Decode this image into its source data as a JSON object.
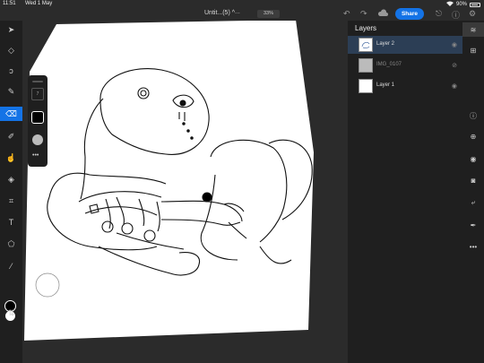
{
  "status": {
    "time": "11:51",
    "date": "Wed 1 May",
    "battery": "90%"
  },
  "document": {
    "title": "Untit...(5)",
    "title_chevron": "^",
    "zoom": "33%",
    "more": "..."
  },
  "toolbar": {
    "undo_icon": "undo-icon",
    "redo_icon": "redo-icon",
    "cloud_icon": "cloud-icon",
    "share_label": "Share",
    "share_color": "#1473e6",
    "export_icon": "export-icon",
    "help_icon": "help-icon",
    "settings_icon": "gear-icon"
  },
  "left_tools": [
    {
      "name": "move-icon",
      "glyph": "➤"
    },
    {
      "name": "transform-icon",
      "glyph": "◇"
    },
    {
      "name": "lasso-icon",
      "glyph": "ↄ"
    },
    {
      "name": "brush-icon",
      "glyph": "✎"
    },
    {
      "name": "eraser-icon",
      "glyph": "⌫",
      "active": true
    },
    {
      "name": "dropper-brush-icon",
      "glyph": "✐"
    },
    {
      "name": "smudge-icon",
      "glyph": "☝"
    },
    {
      "name": "fill-icon",
      "glyph": "◈"
    },
    {
      "name": "crop-icon",
      "glyph": "⌗"
    },
    {
      "name": "type-icon",
      "glyph": "T"
    },
    {
      "name": "shapes-icon",
      "glyph": "⬠"
    },
    {
      "name": "eyedropper-icon",
      "glyph": "⁄"
    },
    {
      "name": "swap-colors-icon",
      "glyph": "⇅"
    }
  ],
  "brush_panel": {
    "size": "7",
    "more": "•••"
  },
  "colors": {
    "foreground": "#000000",
    "background": "#ffffff",
    "accent": "#1473e6"
  },
  "layers": {
    "title": "Layers",
    "items": [
      {
        "name": "Layer 2",
        "selected": true,
        "visible": true
      },
      {
        "name": "IMG_0107",
        "selected": false,
        "visible": false
      },
      {
        "name": "Layer 1",
        "selected": false,
        "visible": true
      }
    ]
  },
  "right_tools": [
    {
      "name": "layers-icon",
      "active": true
    },
    {
      "name": "layer-properties-icon"
    },
    {
      "name": "info-icon"
    },
    {
      "name": "add-layer-icon"
    },
    {
      "name": "visibility-icon"
    },
    {
      "name": "mask-icon"
    },
    {
      "name": "clipping-icon"
    },
    {
      "name": "adjust-icon"
    },
    {
      "name": "more-icon"
    }
  ]
}
